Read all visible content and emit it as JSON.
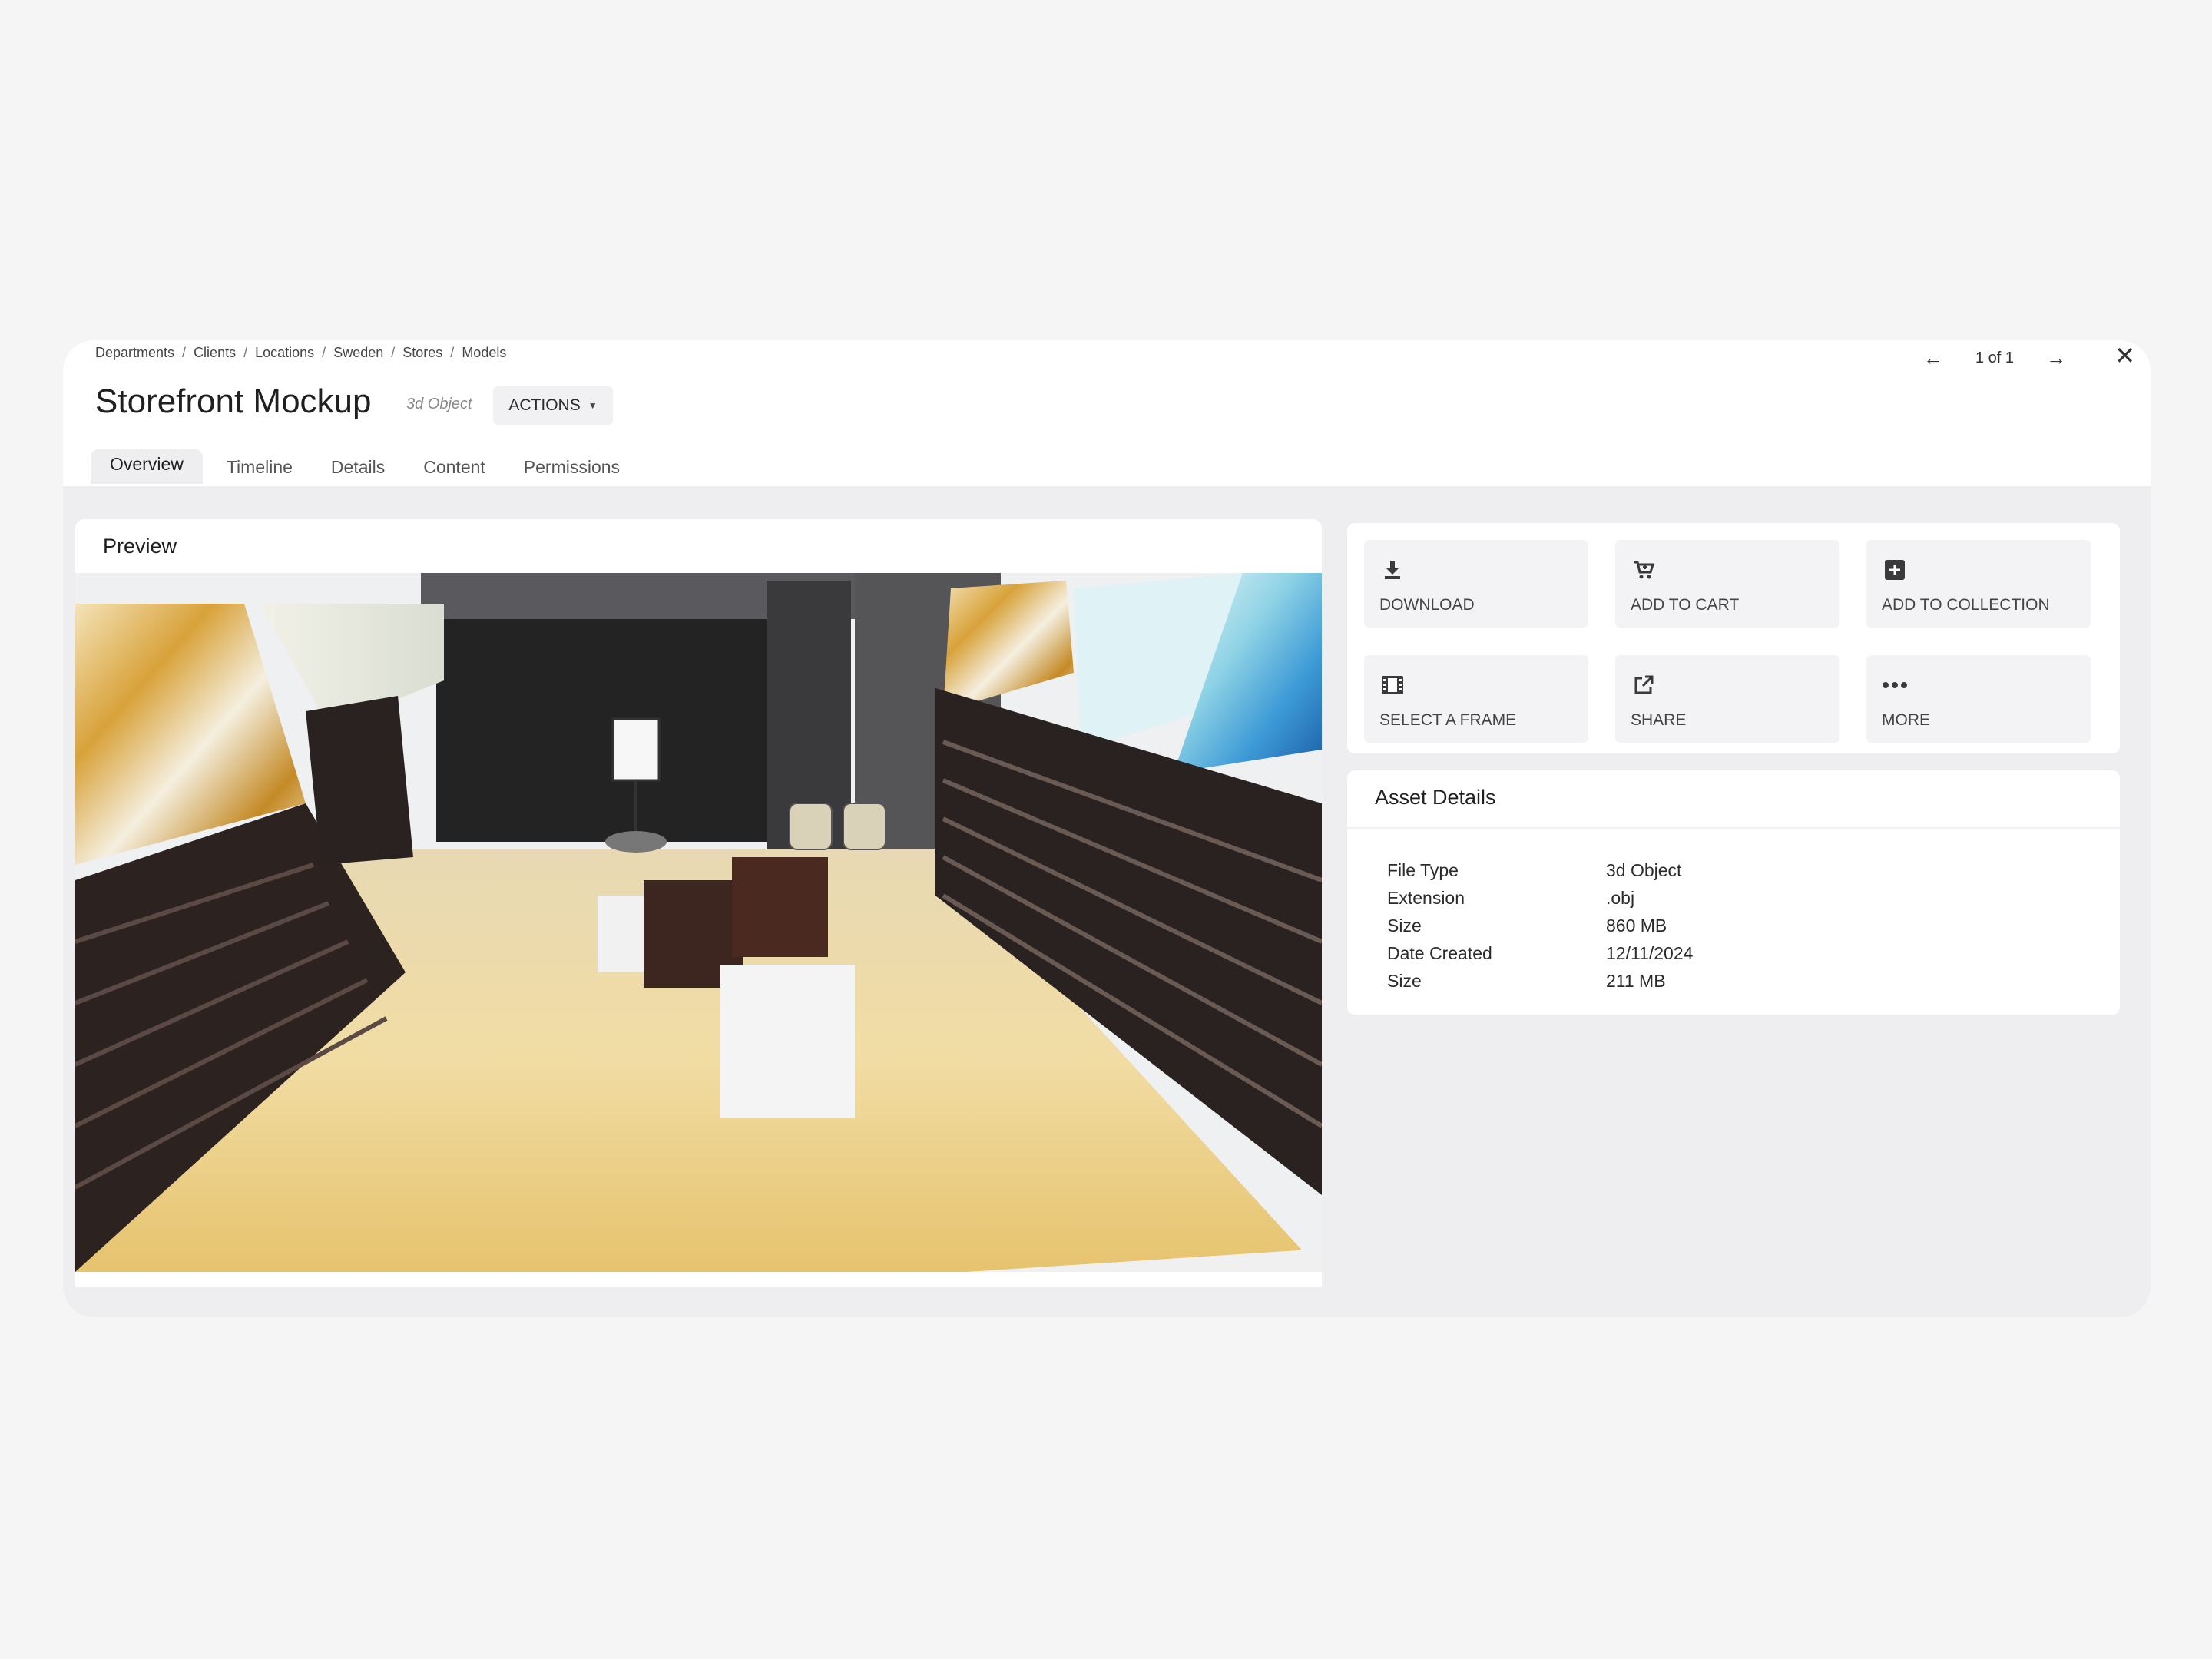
{
  "breadcrumb": [
    "Departments",
    "Clients",
    "Locations",
    "Sweden",
    "Stores",
    "Models"
  ],
  "breadcrumb_separator": "/",
  "header": {
    "title": "Storefront Mockup",
    "type_label": "3d Object",
    "actions_label": "ACTIONS"
  },
  "pager": {
    "text": "1 of 1"
  },
  "tabs": [
    {
      "label": "Overview",
      "active": true
    },
    {
      "label": "Timeline",
      "active": false
    },
    {
      "label": "Details",
      "active": false
    },
    {
      "label": "Content",
      "active": false
    },
    {
      "label": "Permissions",
      "active": false
    }
  ],
  "preview": {
    "title": "Preview"
  },
  "actions": [
    {
      "label": "DOWNLOAD",
      "icon": "download-icon"
    },
    {
      "label": "ADD TO CART",
      "icon": "cart-icon"
    },
    {
      "label": "ADD TO COLLECTION",
      "icon": "add-collection-icon"
    },
    {
      "label": "SELECT A FRAME",
      "icon": "film-frame-icon"
    },
    {
      "label": "SHARE",
      "icon": "share-icon"
    },
    {
      "label": "MORE",
      "icon": "more-icon"
    }
  ],
  "asset_details": {
    "title": "Asset Details",
    "rows": [
      {
        "key": "File Type",
        "value": "3d Object"
      },
      {
        "key": "Extension",
        "value": ".obj"
      },
      {
        "key": "Size",
        "value": "860 MB"
      },
      {
        "key": "Date Created",
        "value": "12/11/2024"
      },
      {
        "key": "Size",
        "value": "211 MB"
      }
    ]
  },
  "colors": {
    "page_bg": "#f5f5f6",
    "panel_bg": "#eeeef0",
    "card_bg": "#ffffff",
    "tile_bg": "#f3f3f5"
  }
}
